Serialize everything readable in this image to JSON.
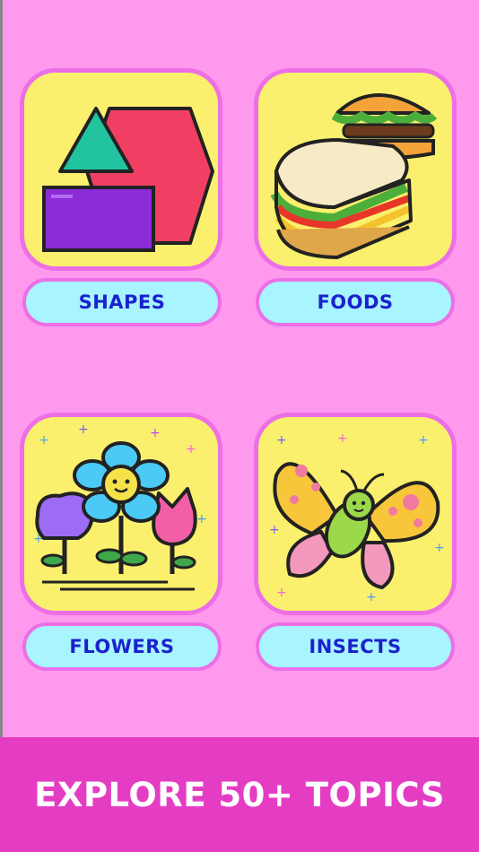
{
  "topics": [
    {
      "label": "SHAPES",
      "icon": "shapes-icon"
    },
    {
      "label": "FOODS",
      "icon": "sandwich-burger-icon"
    },
    {
      "label": "FLOWERS",
      "icon": "flowers-icon"
    },
    {
      "label": "INSECTS",
      "icon": "butterfly-icon"
    }
  ],
  "banner": {
    "text": "EXPLORE 50+ TOPICS"
  },
  "colors": {
    "background": "#ff99ee",
    "card": "#fbf06e",
    "card_border": "#ec6fe6",
    "pill": "#a8f4ff",
    "pill_text": "#1b22cc",
    "banner": "#e43dc4"
  }
}
